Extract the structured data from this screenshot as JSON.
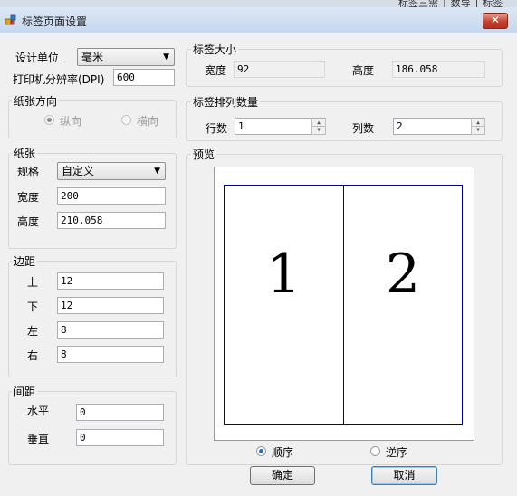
{
  "background_text": "标签三需 │ 数导 │ 标签",
  "window": {
    "title": "标签页面设置",
    "close_symbol": "✕"
  },
  "settings": {
    "unit_label": "设计单位",
    "unit_value": "毫米",
    "dpi_label": "打印机分辨率(DPI)",
    "dpi_value": "600"
  },
  "orientation": {
    "title": "纸张方向",
    "portrait_label": "纵向",
    "landscape_label": "横向",
    "selected": "portrait"
  },
  "paper": {
    "title": "纸张",
    "spec_label": "规格",
    "spec_value": "自定义",
    "width_label": "宽度",
    "width_value": "200",
    "height_label": "高度",
    "height_value": "210.058"
  },
  "margins": {
    "title": "边距",
    "top_label": "上",
    "top_value": "12",
    "bottom_label": "下",
    "bottom_value": "12",
    "left_label": "左",
    "left_value": "8",
    "right_label": "右",
    "right_value": "8"
  },
  "spacing": {
    "title": "间距",
    "horizontal_label": "水平",
    "horizontal_value": "0",
    "vertical_label": "垂直",
    "vertical_value": "0"
  },
  "label_size": {
    "title": "标签大小",
    "width_label": "宽度",
    "width_value": "92",
    "height_label": "高度",
    "height_value": "186.058"
  },
  "label_layout": {
    "title": "标签排列数量",
    "rows_label": "行数",
    "rows_value": "1",
    "cols_label": "列数",
    "cols_value": "2"
  },
  "preview": {
    "title": "预览",
    "cells": [
      "1",
      "2"
    ],
    "order_forward_label": "顺序",
    "order_reverse_label": "逆序",
    "selected_order": "forward"
  },
  "buttons": {
    "ok_label": "确定",
    "cancel_label": "取消"
  },
  "colors": {
    "label_border": "#00008b",
    "close_button": "#c7412c"
  }
}
